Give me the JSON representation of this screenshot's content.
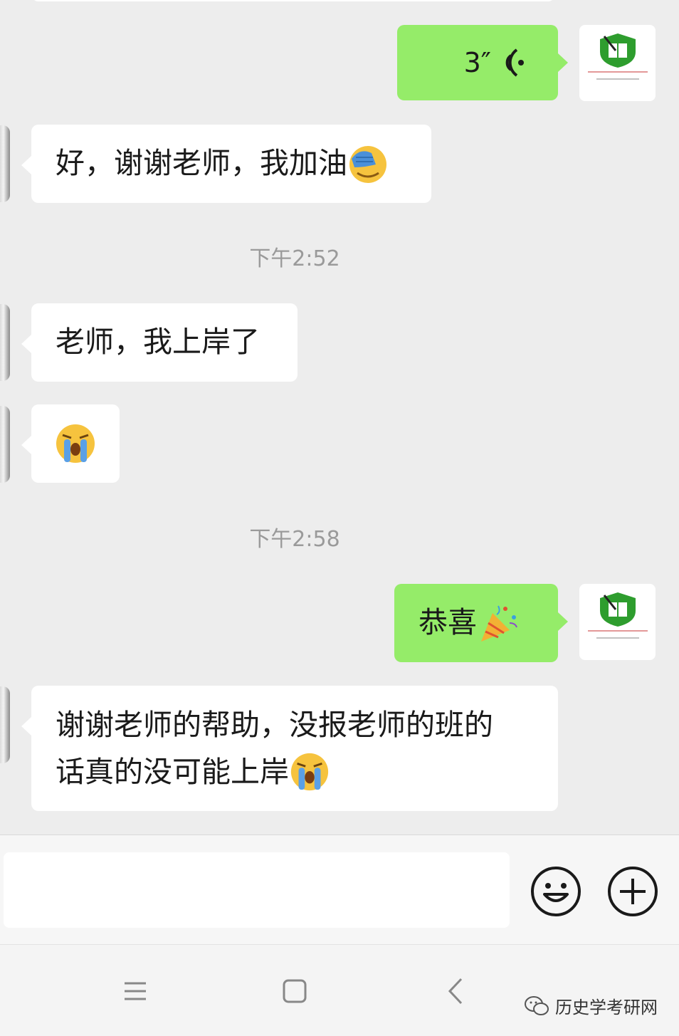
{
  "messages": {
    "voice": {
      "duration": "3″"
    },
    "m1": {
      "text": "好，谢谢老师，我加油"
    },
    "time1": "下午2:52",
    "m2": {
      "text": "老师，我上岸了"
    },
    "time2": "下午2:58",
    "m3": {
      "text": "恭喜"
    },
    "m4": {
      "line1": "谢谢老师的帮助，没报老师的班的",
      "line2": "话真的没可能上岸"
    }
  },
  "input": {
    "placeholder": ""
  },
  "watermark": {
    "text": "历史学考研网"
  },
  "colors": {
    "out_bubble": "#95ec69",
    "in_bubble": "#ffffff",
    "background": "#ededed",
    "logo_green": "#2e9d2e"
  },
  "icons": [
    "voice-wave-icon",
    "facepalm-emoji",
    "loudly-crying-emoji",
    "party-popper-emoji",
    "smiley-button-icon",
    "plus-button-icon",
    "menu-nav-icon",
    "home-nav-icon",
    "back-nav-icon",
    "wechat-logo-icon"
  ]
}
